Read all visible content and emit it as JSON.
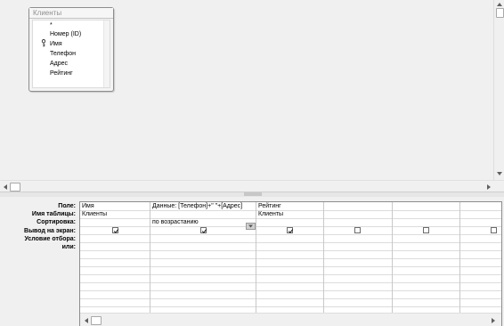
{
  "table_box": {
    "title": "Клиенты",
    "fields": [
      "*",
      "Номер (ID)",
      "Имя",
      "Телефон",
      "Адрес",
      "Рейтинг"
    ],
    "primary_key_field": "Номер (ID)"
  },
  "grid": {
    "row_labels": [
      "Поле:",
      "Имя таблицы:",
      "Сортировка:",
      "Вывод на экран:",
      "Условие отбора:",
      "или:"
    ],
    "columns": [
      {
        "field": "Имя",
        "table": "Клиенты",
        "sort": "",
        "show": true
      },
      {
        "field": "Данные: [Телефон]+\" \"+[Адрес]",
        "table": "",
        "sort": "по возрастанию",
        "show": true
      },
      {
        "field": "Рейтинг",
        "table": "Клиенты",
        "sort": "",
        "show": true
      },
      {
        "field": "",
        "table": "",
        "sort": "",
        "show": false
      },
      {
        "field": "",
        "table": "",
        "sort": "",
        "show": false
      },
      {
        "field": "",
        "table": "",
        "sort": "",
        "show": false
      }
    ]
  },
  "colors": {
    "background": "#f0f0f0",
    "grid_lines": "#dcdcdc",
    "title_text": "#8f8f8f"
  }
}
